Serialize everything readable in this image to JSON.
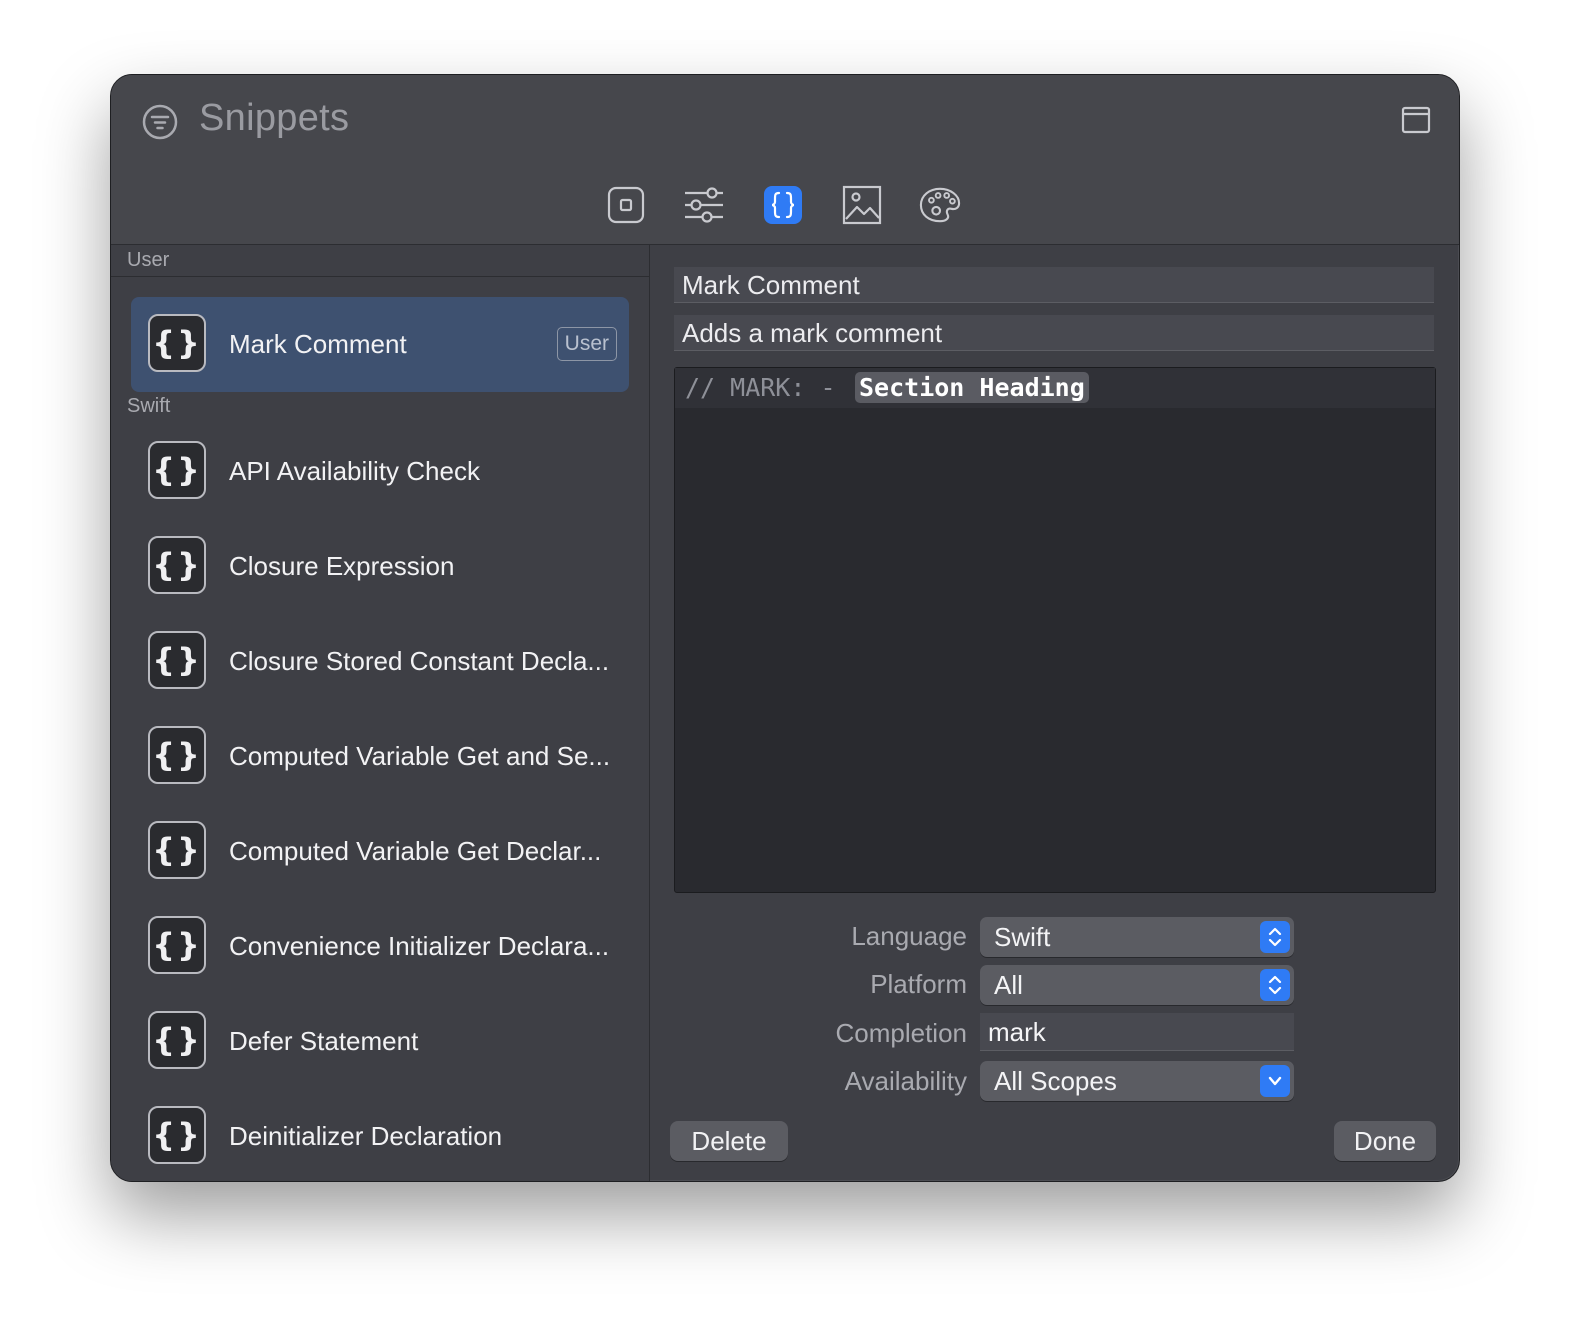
{
  "window": {
    "title": "Snippets",
    "title_icon": "filter-circle-icon",
    "corner_icon": "window-icon"
  },
  "toolbar": {
    "tools": [
      {
        "name": "square-icon",
        "active": false
      },
      {
        "name": "sliders-icon",
        "active": false
      },
      {
        "name": "braces-icon",
        "active": true
      },
      {
        "name": "image-icon",
        "active": false
      },
      {
        "name": "palette-icon",
        "active": false
      }
    ],
    "accent": "#2f7bf5"
  },
  "sidebar": {
    "section_user": "User",
    "section_swift": "Swift",
    "selected": {
      "icon": "{}",
      "label": "Mark Comment",
      "badge": "User"
    },
    "swift_items": [
      {
        "icon": "{}",
        "label": "API Availability Check"
      },
      {
        "icon": "{}",
        "label": "Closure Expression"
      },
      {
        "icon": "{}",
        "label": "Closure Stored Constant Decla..."
      },
      {
        "icon": "{}",
        "label": "Computed Variable Get and Se..."
      },
      {
        "icon": "{}",
        "label": "Computed Variable Get Declar..."
      },
      {
        "icon": "{}",
        "label": "Convenience Initializer Declara..."
      },
      {
        "icon": "{}",
        "label": "Defer Statement"
      },
      {
        "icon": "{}",
        "label": "Deinitializer Declaration"
      }
    ],
    "selection_color": "#3e5170"
  },
  "editor": {
    "title": "Mark Comment",
    "summary": "Adds a mark comment",
    "code_prefix": "// MARK: -",
    "code_token": "Section Heading"
  },
  "form": {
    "language_label": "Language",
    "language_value": "Swift",
    "platform_label": "Platform",
    "platform_value": "All",
    "completion_label": "Completion",
    "completion_value": "mark",
    "availability_label": "Availability",
    "availability_value": "All Scopes"
  },
  "buttons": {
    "delete": "Delete",
    "done": "Done"
  }
}
